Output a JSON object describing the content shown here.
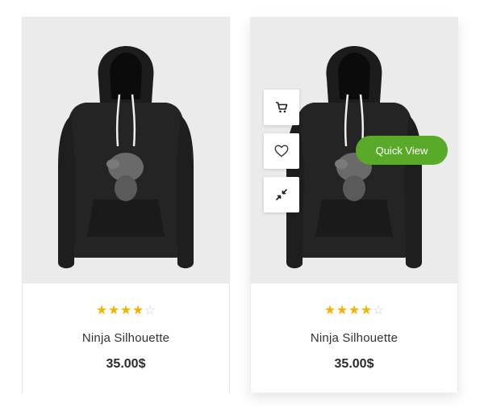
{
  "products": [
    {
      "name": "Ninja Silhouette",
      "price": "35.00$",
      "rating": {
        "filled": 4,
        "total": 5
      },
      "image": "black-hoodie-with-gray-print"
    },
    {
      "name": "Ninja Silhouette",
      "price": "35.00$",
      "rating": {
        "filled": 4,
        "total": 5
      },
      "image": "black-hoodie-with-gray-print",
      "hover_actions": {
        "icons": [
          "cart-icon",
          "heart-icon",
          "compare-arrows-icon"
        ],
        "quick_view_label": "Quick View"
      }
    }
  ],
  "colors": {
    "star": "#f5b301",
    "star_empty": "#c9c9c9",
    "quick_view_bg": "#5aaa2a",
    "image_bg": "#ebebeb"
  }
}
